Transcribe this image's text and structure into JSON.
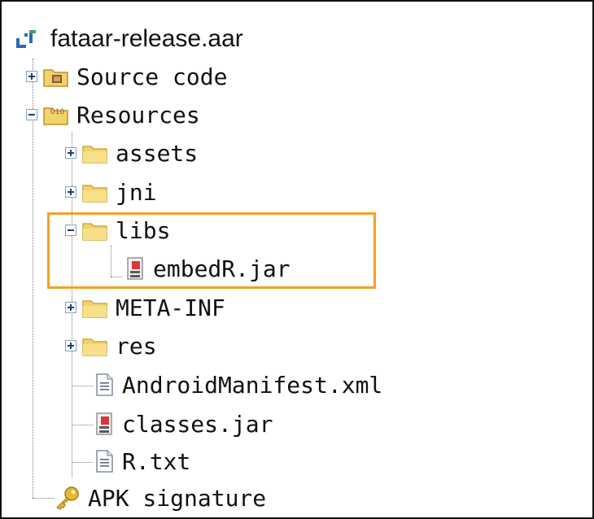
{
  "tree": {
    "root": {
      "label": "fataar-release.aar",
      "icon": "archive-project-icon"
    },
    "items": [
      {
        "label": "Source code",
        "icon": "package-folder-icon",
        "expander": "plus"
      },
      {
        "label": "Resources",
        "icon": "resources-folder-icon",
        "expander": "minus"
      },
      {
        "label": "assets",
        "icon": "folder-icon",
        "expander": "plus"
      },
      {
        "label": "jni",
        "icon": "folder-icon",
        "expander": "plus"
      },
      {
        "label": "libs",
        "icon": "folder-icon",
        "expander": "minus"
      },
      {
        "label": "embedR.jar",
        "icon": "jar-file-icon"
      },
      {
        "label": "META-INF",
        "icon": "folder-icon",
        "expander": "plus"
      },
      {
        "label": "res",
        "icon": "folder-icon",
        "expander": "plus"
      },
      {
        "label": "AndroidManifest.xml",
        "icon": "text-file-icon"
      },
      {
        "label": "classes.jar",
        "icon": "jar-file-icon"
      },
      {
        "label": "R.txt",
        "icon": "text-file-icon"
      },
      {
        "label": "APK signature",
        "icon": "key-icon"
      }
    ]
  },
  "colors": {
    "highlight": "#f5a123",
    "folder": "#f4d26a",
    "expander": "#1f3f7a"
  }
}
